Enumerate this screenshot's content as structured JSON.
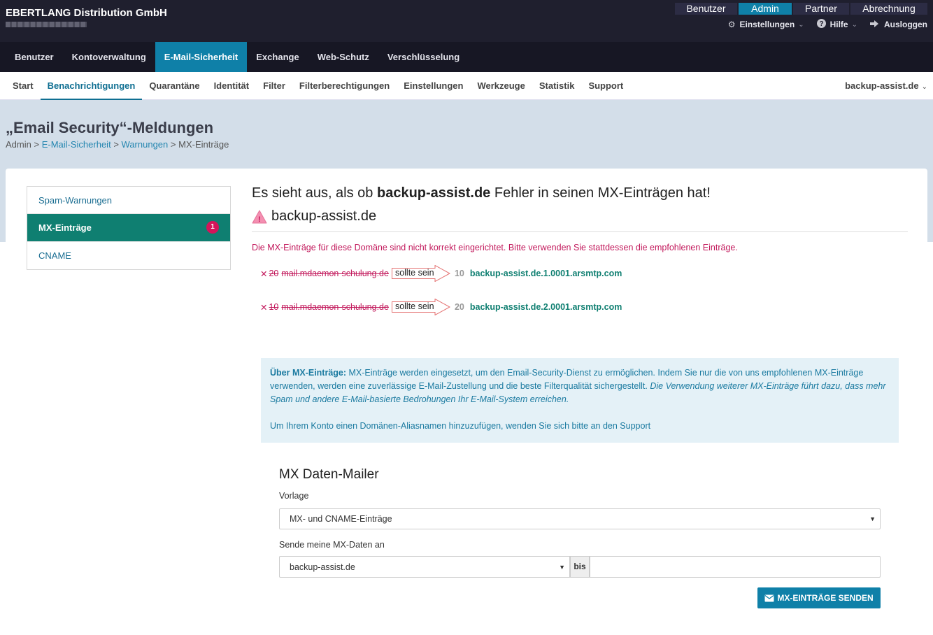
{
  "header": {
    "company": "EBERTLANG Distribution GmbH",
    "role_tabs": [
      "Benutzer",
      "Admin",
      "Partner",
      "Abrechnung"
    ],
    "active_role": "Admin",
    "settings_label": "Einstellungen",
    "help_label": "Hilfe",
    "logout_label": "Ausloggen"
  },
  "main_nav": {
    "items": [
      "Benutzer",
      "Kontoverwaltung",
      "E-Mail-Sicherheit",
      "Exchange",
      "Web-Schutz",
      "Verschlüsselung"
    ],
    "active": "E-Mail-Sicherheit"
  },
  "sub_nav": {
    "items": [
      "Start",
      "Benachrichtigungen",
      "Quarantäne",
      "Identität",
      "Filter",
      "Filterberechtigungen",
      "Einstellungen",
      "Werkzeuge",
      "Statistik",
      "Support"
    ],
    "active": "Benachrichtigungen",
    "domain_select": "backup-assist.de"
  },
  "page": {
    "title": "„Email Security“-Meldungen",
    "breadcrumb": {
      "root": "Admin",
      "sep": ">",
      "link1": "E-Mail-Sicherheit",
      "link2": "Warnungen",
      "current": "MX-Einträge"
    }
  },
  "side_menu": {
    "items": [
      {
        "label": "Spam-Warnungen"
      },
      {
        "label": "MX-Einträge",
        "badge": "1"
      },
      {
        "label": "CNAME"
      }
    ],
    "active": "MX-Einträge"
  },
  "content": {
    "headline_prefix": "Es sieht aus, als ob",
    "headline_domain": "backup-assist.de",
    "headline_suffix": "Fehler in seinen MX-Einträgen hat!",
    "domain": "backup-assist.de",
    "error_message": "Die MX-Einträge für diese Domäne sind nicht korrekt eingerichtet. Bitte verwenden Sie stattdessen die empfohlenen Einträge.",
    "should_be_label": "sollte sein",
    "mx_rows": [
      {
        "old_prio": "20",
        "old_host": "mail.mdaemon-schulung.de",
        "new_prio": "10",
        "new_host": "backup-assist.de.1.0001.arsmtp.com"
      },
      {
        "old_prio": "10",
        "old_host": "mail.mdaemon-schulung.de",
        "new_prio": "20",
        "new_host": "backup-assist.de.2.0001.arsmtp.com"
      }
    ]
  },
  "info": {
    "bold_lead": "Über MX-Einträge:",
    "text": " MX-Einträge werden eingesetzt, um den Email-Security-Dienst zu ermöglichen. Indem Sie nur die von uns empfohlenen MX-Einträge verwenden, werden eine zuverlässige E-Mail-Zustellung und die beste Filterqualität sichergestellt. ",
    "italic": "Die Verwendung weiterer MX-Einträge führt dazu, dass mehr Spam und andere E-Mail-basierte Bedrohungen Ihr E-Mail-System erreichen.",
    "second": "Um Ihrem Konto einen Domänen-Aliasnamen hinzuzufügen, wenden Sie sich bitte an den Support"
  },
  "mailer": {
    "title": "MX Daten-Mailer",
    "template_label": "Vorlage",
    "template_value": "MX- und CNAME-Einträge",
    "send_label": "Sende meine MX-Daten an",
    "domain_value": "backup-assist.de",
    "bis_label": "bis",
    "email_value": "",
    "button_label": "MX-EINTRÄGE SENDEN"
  },
  "colors": {
    "accent": "#0f80a8",
    "teal": "#0f7f71",
    "error": "#c2185b",
    "topbar": "#1f1f2e",
    "hero": "#d3dee9"
  }
}
